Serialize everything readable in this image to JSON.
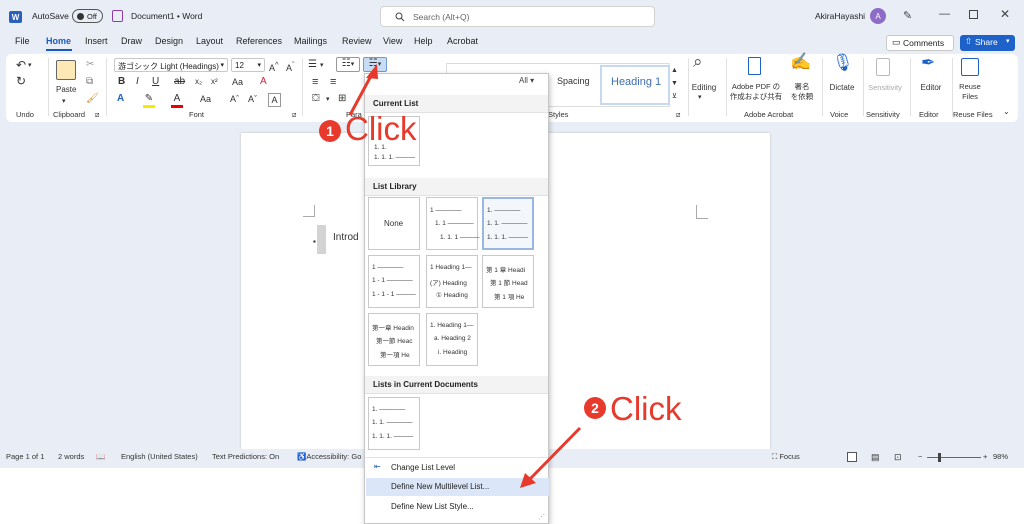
{
  "titlebar": {
    "autosave_label": "AutoSave",
    "autosave_state": "Off",
    "doc_name": "Document1",
    "app_sep": "•",
    "app_name": "Word",
    "search_placeholder": "Search (Alt+Q)",
    "user_name": "AkiraHayashi",
    "avatar_initial": "A"
  },
  "menu": {
    "tabs": [
      "File",
      "Home",
      "Insert",
      "Draw",
      "Design",
      "Layout",
      "References",
      "Mailings",
      "Review",
      "View",
      "Help",
      "Acrobat"
    ],
    "active": "Home",
    "comments_label": "Comments",
    "share_label": "Share"
  },
  "ribbon": {
    "undo_label": "Undo",
    "paste_label": "Paste",
    "clipboard_label": "Clipboard",
    "font_label": "Font",
    "paragraph_label": "Para",
    "styles_label": "Styles",
    "font_name": "游ゴシック Light (Headings)",
    "font_size": "12",
    "style_spacing": "Spacing",
    "style_heading1": "Heading 1",
    "all_filter": "All",
    "editing_label": "Editing",
    "adobe_pdf_label": "Adobe PDF の",
    "adobe_pdf_label2": "作成および共有",
    "sign_label": "署名",
    "sign_label2": "を依頼",
    "adobe_group": "Adobe Acrobat",
    "dictate_label": "Dictate",
    "voice_group": "Voice",
    "sensitivity_label": "Sensitivity",
    "sensitivity_group": "Sensitivity",
    "editor_label": "Editor",
    "editor_group": "Editor",
    "reuse_label": "Reuse",
    "reuse_label2": "Files",
    "reuse_group": "Reuse Files"
  },
  "document": {
    "text": "Introd"
  },
  "panel": {
    "current_list_header": "Current List",
    "list_library_header": "List Library",
    "lists_in_docs_header": "Lists in Current Documents",
    "none_label": "None",
    "current_thumb": [
      "1.",
      "1. 1.",
      "1. 1. 1. ———"
    ],
    "library": [
      [
        "None"
      ],
      [
        "1 ————",
        "1. 1 ————",
        "1. 1. 1 ———"
      ],
      [
        "1. ————",
        "1. 1. ————",
        "1. 1. 1. ———"
      ],
      [
        "1 ————",
        "1 - 1 ————",
        "1 - 1 - 1 ———"
      ],
      [
        "1 Heading 1—",
        "(ア) Heading",
        "① Heading"
      ],
      [
        "第 1 章 Headi",
        "第 1 節 Head",
        "第 1 項 He"
      ],
      [
        "第一章 Headin",
        "第一節 Heac",
        "第一項 He"
      ],
      [
        "1. Heading 1—",
        "a. Heading 2",
        "i. Heading"
      ]
    ],
    "docs_thumb": [
      "1. ————",
      "1. 1. ————",
      "1. 1. 1. ———"
    ],
    "change_level": "Change List Level",
    "define_multilevel": "Define New Multilevel List...",
    "define_style": "Define New List Style..."
  },
  "annotations": {
    "badge1": "1",
    "click1": "Click",
    "badge2": "2",
    "click2": "Click",
    "color": "#e7392c"
  },
  "status": {
    "page": "Page 1 of 1",
    "words": "2 words",
    "language": "English (United States)",
    "predictions": "Text Predictions: On",
    "accessibility": "Accessibility: Go",
    "focus": "Focus",
    "zoom": "98%"
  }
}
